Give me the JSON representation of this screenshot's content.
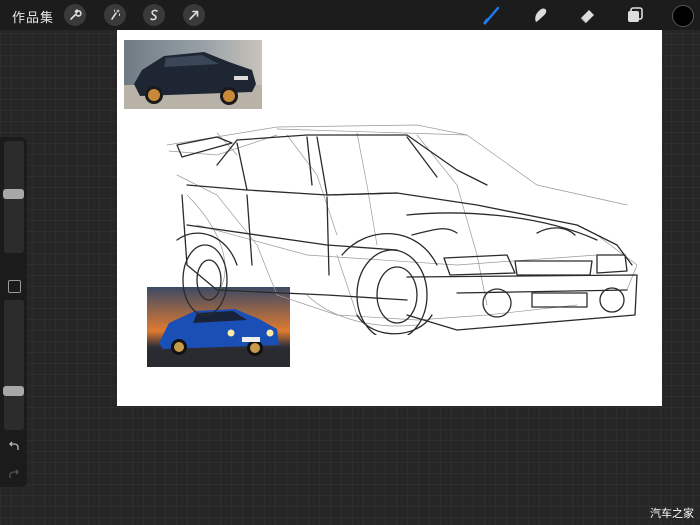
{
  "toolbar": {
    "gallery_label": "作品集",
    "left_tools": [
      "wrench-icon",
      "magic-wand-icon",
      "selection-icon",
      "transform-arrow-icon"
    ],
    "right_tools": [
      "brush-icon",
      "smudge-icon",
      "eraser-icon",
      "layers-icon"
    ],
    "active_tool": "brush-icon",
    "accent_color": "#1e7cf0",
    "current_color": "#000000"
  },
  "sidebar": {
    "brush_size_level": 0.53,
    "opacity_level": 0.28,
    "undo_icon": "undo-icon",
    "redo_icon": "redo-icon"
  },
  "canvas": {
    "background": "#ffffff"
  },
  "watermark": "汽车之家"
}
